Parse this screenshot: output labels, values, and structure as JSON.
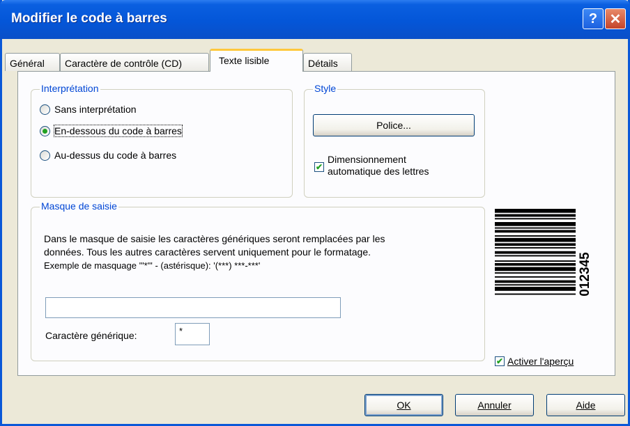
{
  "window": {
    "title": "Modifier le code à barres"
  },
  "titlebar": {
    "help_glyph": "?",
    "close_glyph": "✕"
  },
  "tabs": [
    {
      "label": "Général"
    },
    {
      "label": "Caractère de contrôle (CD)"
    },
    {
      "label": "Texte lisible",
      "active": true
    },
    {
      "label": "Détails"
    }
  ],
  "interpretation": {
    "legend": "Interprétation",
    "options": [
      {
        "label": "Sans interprétation",
        "checked": false
      },
      {
        "label": "En-dessous du code à barres",
        "checked": true
      },
      {
        "label": "Au-dessus du code à barres",
        "checked": false
      }
    ]
  },
  "style": {
    "legend": "Style",
    "font_button": "Police...",
    "auto_size_line1": "Dimensionnement",
    "auto_size_line2": "automatique des lettres",
    "auto_size_checked": true
  },
  "mask": {
    "legend": "Masque de saisie",
    "description_line1": "Dans le masque de saisie les caractères génériques seront remplacées par les",
    "description_line2": "données. Tous les autres caractères servent uniquement pour le formatage.",
    "description_line3": "Exemple de masquage '\"*\"' - (astérisque): '(***) ***-***'",
    "input_value": "",
    "wildcard_label": "Caractère générique:",
    "wildcard_value": "*"
  },
  "preview": {
    "barcode_text": "012345",
    "enable_label": "Activer l'aperçu",
    "enable_checked": true
  },
  "footer": {
    "ok": "OK",
    "cancel": "Annuler",
    "help": "Aide"
  }
}
